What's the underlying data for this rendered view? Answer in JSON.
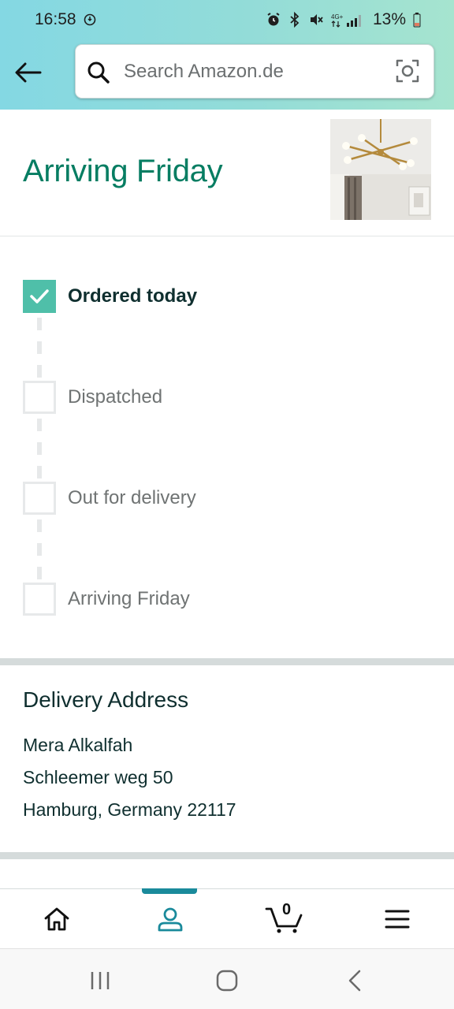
{
  "status_bar": {
    "time": "16:58",
    "battery_percent": "13%",
    "network": "4G+"
  },
  "search": {
    "placeholder": "Search Amazon.de"
  },
  "delivery": {
    "arriving_title": "Arriving Friday",
    "product_image": "ceiling-lamp-photo"
  },
  "tracker": {
    "steps": [
      {
        "label": "Ordered today",
        "done": true
      },
      {
        "label": "Dispatched",
        "done": false
      },
      {
        "label": "Out for delivery",
        "done": false
      },
      {
        "label": "Arriving Friday",
        "done": false
      }
    ]
  },
  "address": {
    "heading": "Delivery Address",
    "name": "Mera Alkalfah",
    "street": "Schleemer weg 50",
    "city_line": "Hamburg, Germany 22117"
  },
  "bottom_nav": {
    "items": [
      "home-icon",
      "account-icon",
      "cart-icon",
      "menu-icon"
    ],
    "active": "account",
    "cart_count": "0"
  },
  "colors": {
    "accent_teal": "#067d62",
    "check_green": "#4fbfa9",
    "nav_indicator": "#1a8a9b"
  }
}
